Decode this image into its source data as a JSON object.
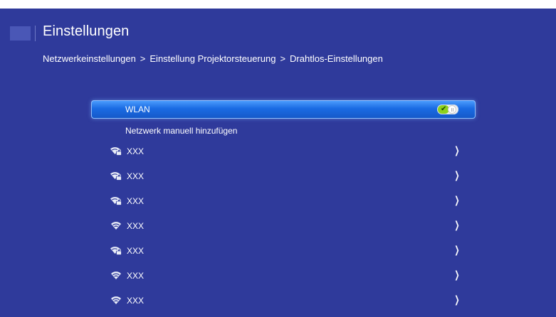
{
  "header": {
    "title": "Einstellungen"
  },
  "breadcrumb": {
    "items": [
      "Netzwerkeinstellungen",
      "Einstellung Projektorsteuerung",
      "Drahtlos-Einstellungen"
    ],
    "separator": ">"
  },
  "wlan": {
    "label": "WLAN",
    "toggle_state": "on"
  },
  "add_network": {
    "label": "Netzwerk manuell hinzufügen"
  },
  "networks": [
    {
      "name": "XXX",
      "icon": "wifi-lock-icon"
    },
    {
      "name": "XXX",
      "icon": "wifi-lock-icon"
    },
    {
      "name": "XXX",
      "icon": "wifi-lock-icon"
    },
    {
      "name": "XXX",
      "icon": "wifi-icon"
    },
    {
      "name": "XXX",
      "icon": "wifi-lock-icon"
    },
    {
      "name": "XXX",
      "icon": "wifi-icon"
    },
    {
      "name": "XXX",
      "icon": "wifi-icon"
    }
  ],
  "chevron_glyph": "❯",
  "colors": {
    "background": "#2f3a9b",
    "selected_row": "#1a6be3",
    "toggle_on": "#8ed11d"
  }
}
